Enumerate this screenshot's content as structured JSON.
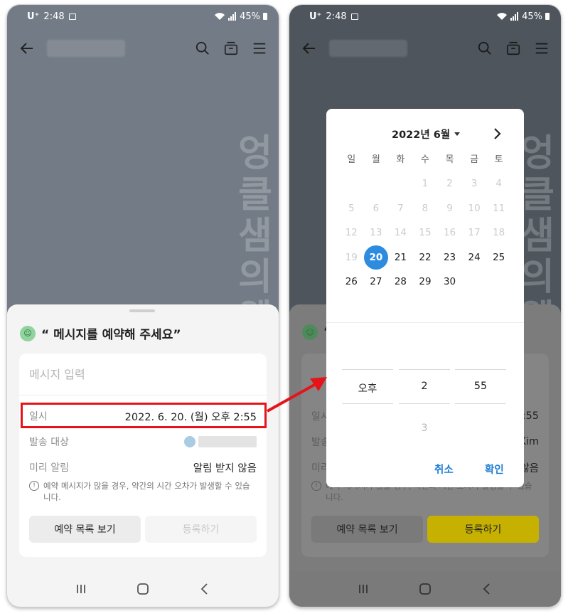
{
  "status": {
    "carrier": "U⁺",
    "time": "2:48",
    "battery": "45%"
  },
  "watermark": "엉클샘의웹자료정리",
  "sheet": {
    "title": "“ 메시지를 예약해 주세요”",
    "message_placeholder": "메시지 입력",
    "datetime_label": "일시",
    "datetime_value": "2022. 6. 20. (월) 오후 2:55",
    "recipient_label": "발송 대상",
    "recipient_value_right": "Kim",
    "reminder_label": "미리 알림",
    "reminder_value": "알림 받지 않음",
    "notice": "예약 메시지가 많을 경우, 약간의 시간 오차가 발생할 수 있습니다.",
    "btn_list": "예약 목록 보기",
    "btn_register": "등록하기"
  },
  "right_sheet": {
    "title_fragment": "“",
    "datetime_value_fragment": ":55",
    "reminder_value_fragment": "않음",
    "notice_fragment": "예약 메시지가 많을 경우, 약간의 시간 오차가 발생할 수 있습니다."
  },
  "calendar": {
    "month_title": "2022년 6월",
    "weekdays": [
      "일",
      "월",
      "화",
      "수",
      "목",
      "금",
      "토"
    ],
    "weeks": [
      [
        "",
        "",
        "",
        "1",
        "2",
        "3",
        "4"
      ],
      [
        "5",
        "6",
        "7",
        "8",
        "9",
        "10",
        "11"
      ],
      [
        "12",
        "13",
        "14",
        "15",
        "16",
        "17",
        "18"
      ],
      [
        "19",
        "20",
        "21",
        "22",
        "23",
        "24",
        "25"
      ],
      [
        "26",
        "27",
        "28",
        "29",
        "30",
        "",
        ""
      ]
    ],
    "selected_day": "20",
    "first_enabled_day": 20
  },
  "time_picker": {
    "ampm": "오후",
    "hour": "2",
    "minute": "55",
    "next_hour": "3"
  },
  "dialog_buttons": {
    "cancel": "취소",
    "confirm": "확인"
  },
  "colors": {
    "accent": "#2d8be0",
    "highlight_box": "#e5141b",
    "register_active": "#c6b000"
  }
}
